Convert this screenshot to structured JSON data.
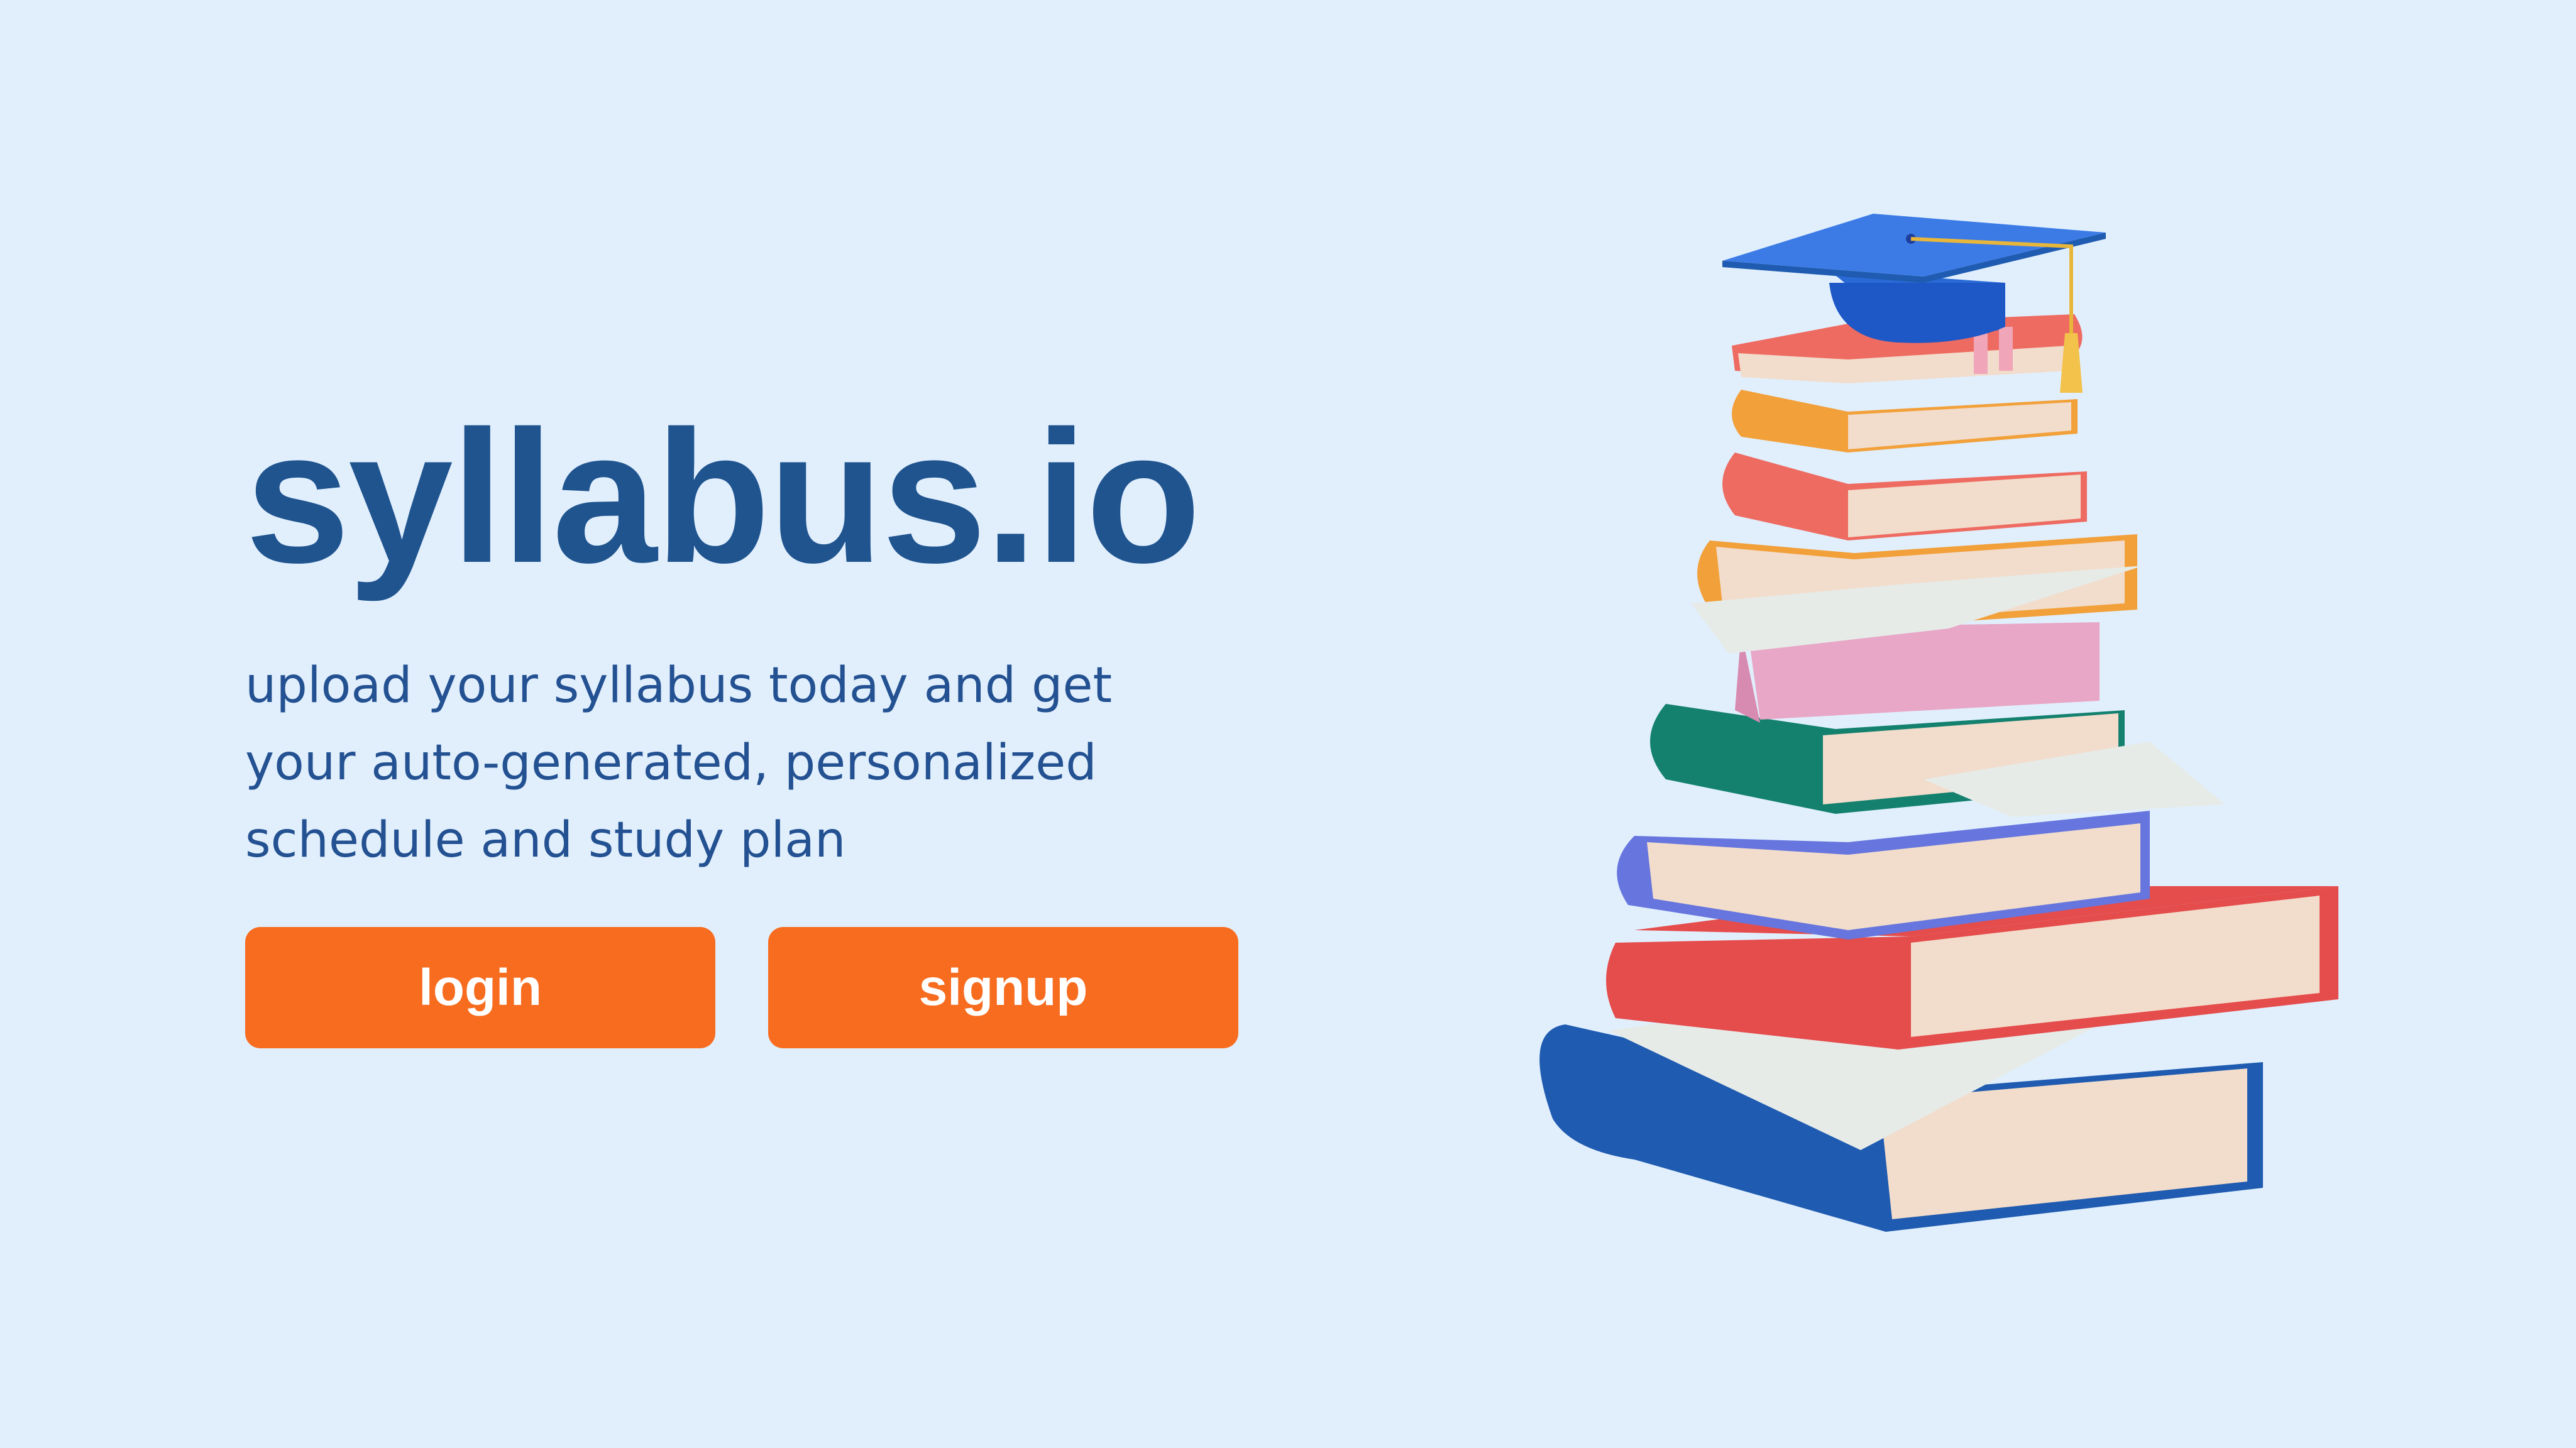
{
  "brand": {
    "name": "syllabus.io"
  },
  "hero": {
    "tagline_lines": [
      "upload your syllabus today and get",
      "your auto-generated, personalized",
      "schedule and study plan"
    ]
  },
  "actions": {
    "login_label": "login",
    "signup_label": "signup"
  },
  "illustration": {
    "icon": "book-stack-with-graduation-cap"
  },
  "colors": {
    "background": "#e1effd",
    "brand_text": "#20548f",
    "body_text": "#235191",
    "button": "#f76c1f",
    "button_text": "#ffffff"
  }
}
